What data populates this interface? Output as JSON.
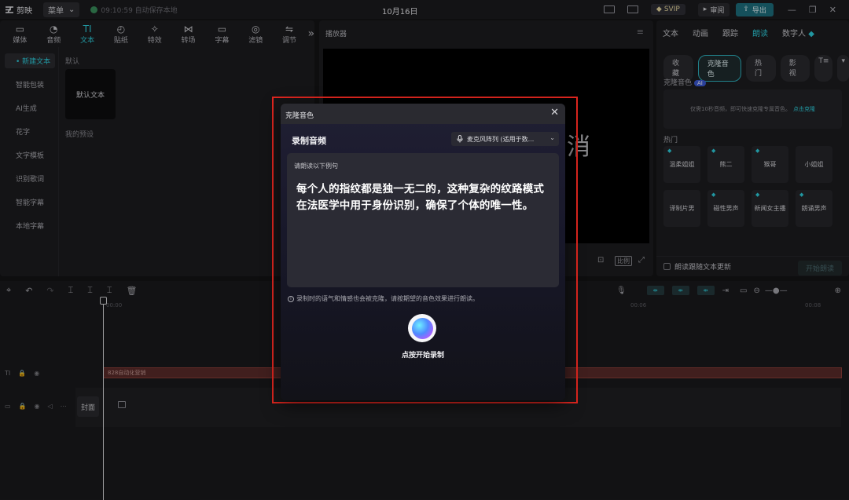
{
  "topbar": {
    "app_name": "剪映",
    "menu_label": "菜单",
    "autosave_text": "09:10:59 自动保存本地",
    "doc_title": "10月16日",
    "svip_label": "SVIP",
    "review_label": "审阅",
    "export_label": "导出"
  },
  "tools": [
    {
      "label": "媒体",
      "icon": "media-icon"
    },
    {
      "label": "音频",
      "icon": "audio-icon"
    },
    {
      "label": "文本",
      "icon": "text-icon"
    },
    {
      "label": "贴纸",
      "icon": "sticker-icon"
    },
    {
      "label": "特效",
      "icon": "effects-icon"
    },
    {
      "label": "转场",
      "icon": "transition-icon"
    },
    {
      "label": "字幕",
      "icon": "subtitle-icon"
    },
    {
      "label": "滤镜",
      "icon": "filter-icon"
    },
    {
      "label": "调节",
      "icon": "adjust-icon"
    }
  ],
  "text_sidebar": [
    "• 新建文本",
    "智能包装",
    "AI生成",
    "花字",
    "文字模板",
    "识别歌词",
    "智能字幕",
    "本地字幕"
  ],
  "text_panel": {
    "default_section": "默认",
    "default_card": "默认文本",
    "preset_section": "我的预设"
  },
  "player": {
    "title": "播放器",
    "overlay_char": "消",
    "ratio_label": "比例"
  },
  "right_panel": {
    "tabs": [
      "文本",
      "动画",
      "跟踪",
      "朗读",
      "数字人"
    ],
    "chips": [
      "收藏",
      "克隆音色",
      "热门",
      "影视"
    ],
    "clone_label": "克隆音色",
    "ai_badge": "AI",
    "clone_hint": "仅需10秒音频，即可快速克隆专属音色。",
    "clone_link": "点击克隆",
    "hot_label": "热门",
    "voices": [
      "温柔姐姐",
      "熊二",
      "猴哥",
      "小姐姐",
      "译制片男",
      "磁性男声",
      "新闻女主播",
      "朗诵男声"
    ],
    "follow_text": "朗读跟随文本更新",
    "start_read": "开始朗读"
  },
  "timeline": {
    "ruler": [
      "00:00",
      "00:06",
      "00:08"
    ],
    "text_clip": "828自动化营销",
    "cover_label": "封面"
  },
  "modal": {
    "title": "克隆音色",
    "record_label": "录制音频",
    "mic_select": "麦克风阵列 (适用于数...",
    "read_hint": "请朗读以下例句",
    "read_text": "每个人的指纹都是独一无二的，这种复杂的纹路模式在法医学中用于身份识别，确保了个体的唯一性。",
    "note": "录制时的语气和情感也会被克隆，请按期望的音色效果进行朗读。",
    "record_cta": "点按开始录制"
  },
  "colors": {
    "accent": "#2fd1e0",
    "highlight_frame": "#e0261f",
    "export_button": "#1e6f7e"
  }
}
